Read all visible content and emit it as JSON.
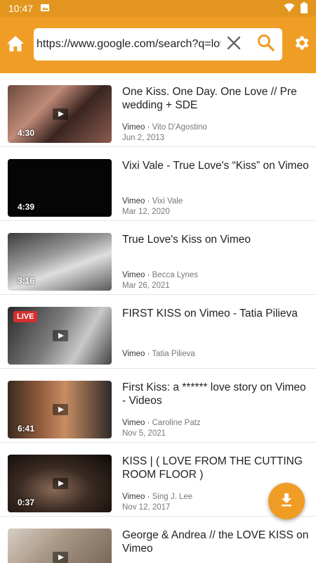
{
  "status_bar": {
    "time": "10:47",
    "icons": [
      "image-icon",
      "wifi-icon",
      "battery-icon"
    ]
  },
  "toolbar": {
    "url_value": "https://www.google.com/search?q=lov",
    "home_icon": "home-icon",
    "clear_icon": "close-icon",
    "search_icon": "search-icon",
    "settings_icon": "gear-icon",
    "accent_color": "#f09d26"
  },
  "results": [
    {
      "title": "One Kiss. One Day. One Love // Pre wedding + SDE",
      "source": "Vimeo",
      "author": "Vito D'Agostino",
      "date": "Jun 2, 2013",
      "duration": "4:30",
      "live": ""
    },
    {
      "title": "Vixi Vale - True Love's “Kiss” on Vimeo",
      "source": "Vimeo",
      "author": "Vixi Vale",
      "date": "Mar 12, 2020",
      "duration": "4:39",
      "live": ""
    },
    {
      "title": "True Love's Kiss on Vimeo",
      "source": "Vimeo",
      "author": "Becca Lynes",
      "date": "Mar 26, 2021",
      "duration": "3:16",
      "live": ""
    },
    {
      "title": "FIRST KISS on Vimeo - Tatia Pilieva",
      "source": "Vimeo",
      "author": "Tatia Pilieva",
      "date": "",
      "duration": "",
      "live": "LIVE"
    },
    {
      "title": "First Kiss: a ****** love story on Vimeo - Videos",
      "source": "Vimeo",
      "author": "Caroline Patz",
      "date": "Nov 5, 2021",
      "duration": "6:41",
      "live": ""
    },
    {
      "title": "KISS | ( LOVE FROM THE CUTTING ROOM FLOOR )",
      "source": "Vimeo",
      "author": "Sing J. Lee",
      "date": "Nov 12, 2017",
      "duration": "0:37",
      "live": ""
    },
    {
      "title": "George & Andrea // the LOVE KISS on Vimeo",
      "source": "",
      "author": "",
      "date": "",
      "duration": "",
      "live": ""
    }
  ],
  "meta_separator": " · ",
  "fab": {
    "icon": "download-icon"
  }
}
